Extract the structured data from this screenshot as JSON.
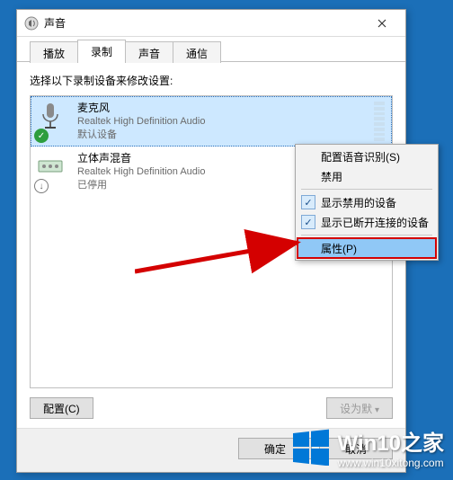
{
  "dialog": {
    "title": "声音",
    "close_tooltip": "关闭"
  },
  "tabs": {
    "playback": "播放",
    "record": "录制",
    "sounds": "声音",
    "comm": "通信"
  },
  "instruction": "选择以下录制设备来修改设置:",
  "devices": [
    {
      "name": "麦克风",
      "driver": "Realtek High Definition Audio",
      "status": "默认设备",
      "status_badge": "✓"
    },
    {
      "name": "立体声混音",
      "driver": "Realtek High Definition Audio",
      "status": "已停用",
      "status_badge": "↓"
    }
  ],
  "buttons": {
    "configure": "配置(C)",
    "set_default": "设为默",
    "ok": "确定",
    "cancel": "取消"
  },
  "context_menu": {
    "configure_sr": "配置语音识别(S)",
    "disable": "禁用",
    "show_disabled": "显示禁用的设备",
    "show_disconnected": "显示已断开连接的设备",
    "properties": "属性(P)"
  },
  "watermark": {
    "title": "Win10之家",
    "url": "www.win10xitong.com"
  }
}
